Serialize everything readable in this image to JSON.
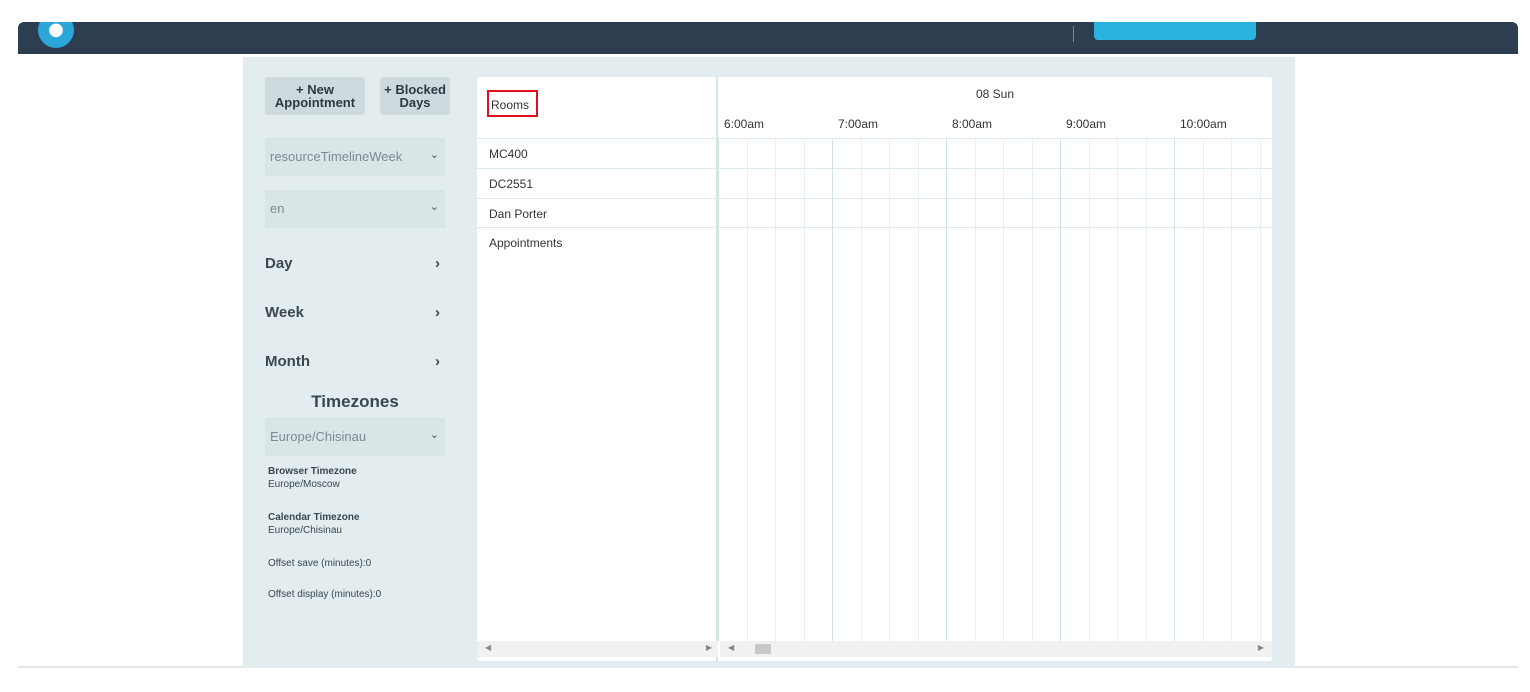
{
  "sidebar": {
    "new_appointment_label": "+ New Appointment",
    "blocked_days_label": "+ Blocked Days",
    "view_select": {
      "value": "resourceTimelineWeek"
    },
    "lang_select": {
      "value": "en"
    },
    "nav": [
      {
        "label": "Day"
      },
      {
        "label": "Week"
      },
      {
        "label": "Month"
      }
    ],
    "timezones_title": "Timezones",
    "tz_select": {
      "value": "Europe/Chisinau"
    },
    "browser_tz": {
      "label": "Browser Timezone",
      "value": "Europe/Moscow"
    },
    "calendar_tz": {
      "label": "Calendar Timezone",
      "value": "Europe/Chisinau"
    },
    "offset_save": "Offset save (minutes):0",
    "offset_display": "Offset display (minutes):0"
  },
  "calendar": {
    "resources_header": "Rooms",
    "resources": [
      "MC400",
      "DC2551",
      "Dan Porter",
      "Appointments"
    ],
    "date_header": "08 Sun",
    "hours": [
      "6:00am",
      "7:00am",
      "8:00am",
      "9:00am",
      "10:00am"
    ]
  },
  "colors": {
    "topbar": "#2d3e50",
    "panel": "#e3ecef",
    "highlight_border": "#e0101a"
  }
}
